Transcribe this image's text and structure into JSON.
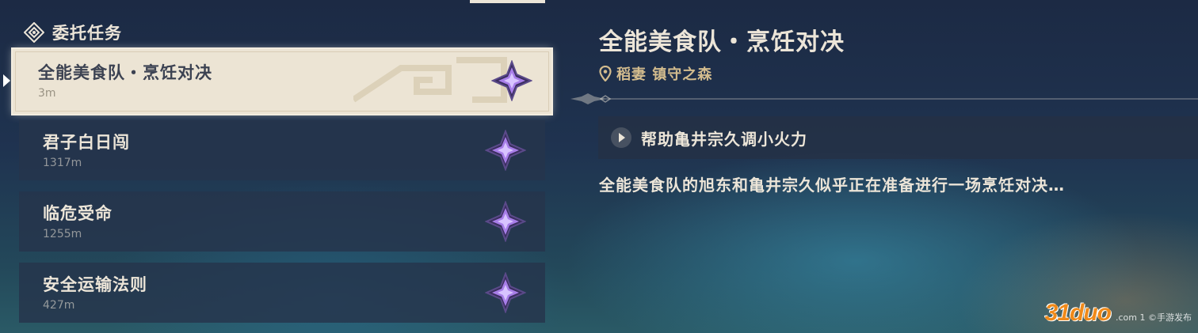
{
  "header": {
    "title": "委托任务",
    "icon": "commission-diamond-icon"
  },
  "quests": [
    {
      "name": "全能美食队・烹饪对决",
      "distance": "3m",
      "selected": true
    },
    {
      "name": "君子白日闯",
      "distance": "1317m"
    },
    {
      "name": "临危受命",
      "distance": "1255m"
    },
    {
      "name": "安全运输法则",
      "distance": "427m"
    }
  ],
  "detail": {
    "title": "全能美食队・烹饪对决",
    "location": "稻妻 镇守之森",
    "objective": "帮助亀井宗久调小火力",
    "description": "全能美食队的旭东和亀井宗久似乎正在准备进行一场烹饪对决…"
  },
  "watermark": {
    "logo": "31duo",
    "small": ".com 1 ©手游发布"
  },
  "colors": {
    "accent_gold": "#d3bc8e",
    "text_light": "#ece5d8",
    "selected_bg": "#ece4d4",
    "star_purple": "#a77de8"
  }
}
